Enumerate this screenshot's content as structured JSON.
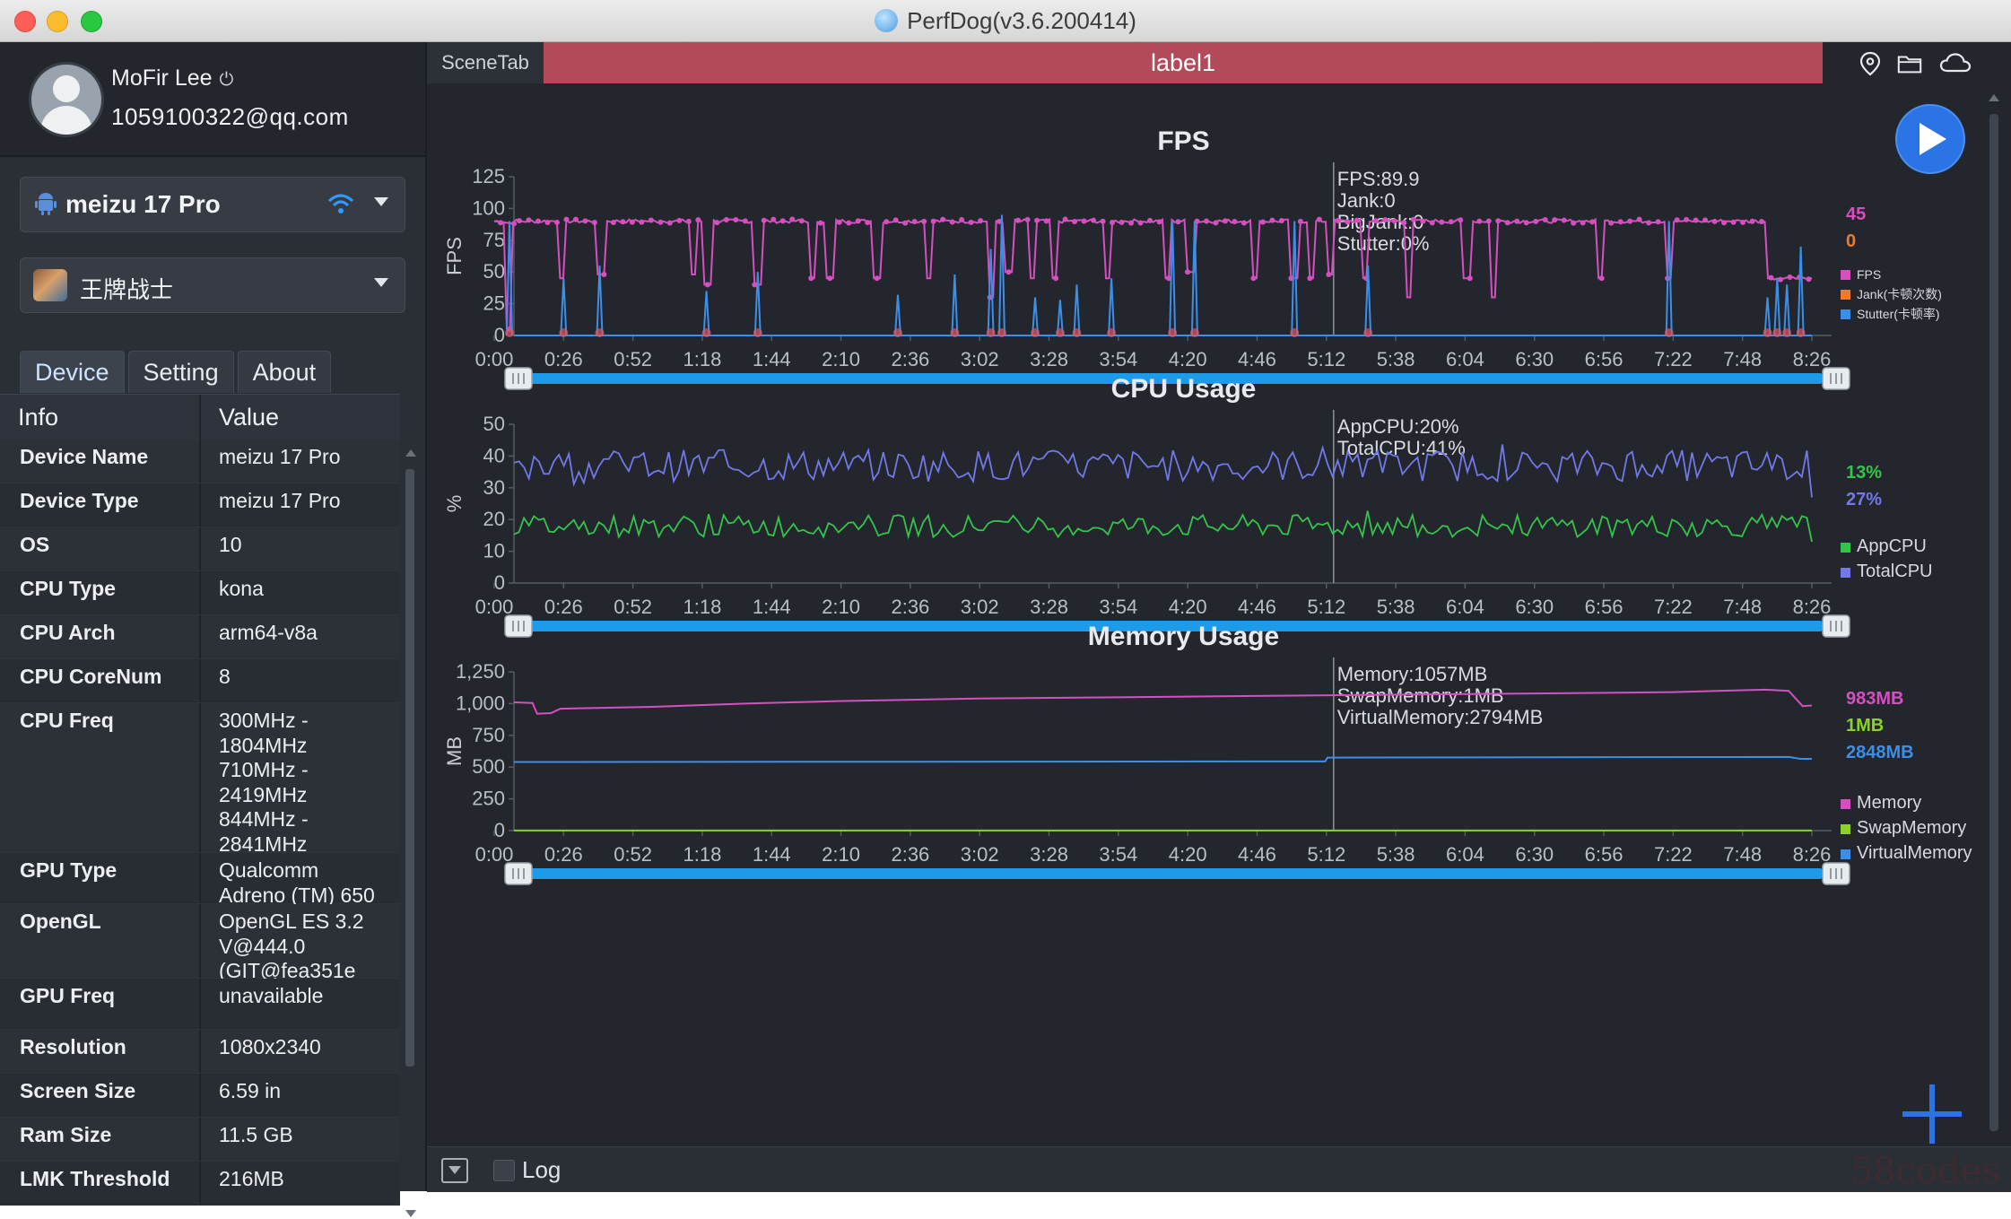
{
  "window": {
    "title": "PerfDog(v3.6.200414)"
  },
  "user": {
    "name": "MoFir Lee",
    "email": "1059100322@qq.com"
  },
  "device_selector": {
    "label": "meizu 17 Pro"
  },
  "app_selector": {
    "label": "王牌战士"
  },
  "sidebar_tabs": [
    {
      "label": "Device",
      "active": true
    },
    {
      "label": "Setting",
      "active": false
    },
    {
      "label": "About",
      "active": false
    }
  ],
  "info_table": {
    "headers": {
      "key": "Info",
      "value": "Value"
    },
    "rows": [
      {
        "key": "Device Name",
        "value": "meizu 17 Pro"
      },
      {
        "key": "Device Type",
        "value": "meizu 17 Pro"
      },
      {
        "key": "OS",
        "value": "10"
      },
      {
        "key": "CPU Type",
        "value": "kona"
      },
      {
        "key": "CPU Arch",
        "value": "arm64-v8a"
      },
      {
        "key": "CPU CoreNum",
        "value": "8"
      },
      {
        "key": "CPU Freq",
        "value": "300MHz -\n1804MHz\n710MHz -\n2419MHz\n844MHz -\n2841MHz"
      },
      {
        "key": "GPU Type",
        "value": "Qualcomm\nAdreno (TM) 650"
      },
      {
        "key": "OpenGL",
        "value": "OpenGL ES 3.2\nV@444.0\n(GIT@fea351e"
      },
      {
        "key": "GPU Freq",
        "value": "unavailable"
      },
      {
        "key": "Resolution",
        "value": "1080x2340"
      },
      {
        "key": "Screen Size",
        "value": "6.59 in"
      },
      {
        "key": "Ram Size",
        "value": "11.5 GB"
      },
      {
        "key": "LMK Threshold",
        "value": "216MB"
      }
    ]
  },
  "scene": {
    "tab_label": "SceneTab",
    "label": "label1"
  },
  "bottom": {
    "log_label": "Log",
    "watermark": "58codes"
  },
  "colors": {
    "fps": "#d64fc0",
    "jank": "#f07a2a",
    "stutter": "#3d8ee6",
    "app_cpu": "#35c44b",
    "total_cpu": "#7378e8",
    "memory": "#d64fc0",
    "swap": "#8ad12a",
    "virtual": "#3d8ee6",
    "label_bar": "#b24a5a",
    "slider": "#1e9be8"
  },
  "chart_data": [
    {
      "type": "line",
      "title": "FPS",
      "ylabel": "FPS",
      "ylim": [
        0,
        125
      ],
      "yticks": [
        "0",
        "25",
        "50",
        "75",
        "100",
        "125"
      ],
      "x_ticks": [
        "0:00",
        "0:26",
        "0:52",
        "1:18",
        "1:44",
        "2:10",
        "2:36",
        "3:02",
        "3:28",
        "3:54",
        "4:20",
        "4:46",
        "5:12",
        "5:38",
        "6:04",
        "6:30",
        "6:56",
        "7:22",
        "7:48",
        "8:26"
      ],
      "cursor": {
        "time": "5:12",
        "readout": [
          "FPS:89.9",
          "Jank:0",
          "BigJank:0",
          "Stutter:0%"
        ]
      },
      "current_values": [
        {
          "text": "45",
          "color": "#d64fc0"
        },
        {
          "text": "0",
          "color": "#f07a2a"
        }
      ],
      "legend": [
        {
          "name": "FPS",
          "color": "#d64fc0"
        },
        {
          "name": "Jank(卡顿次数)",
          "color": "#f07a2a"
        },
        {
          "name": "Stutter(卡顿率)",
          "color": "#3d8ee6"
        }
      ],
      "series": [
        {
          "name": "FPS",
          "base": 90,
          "dips": [
            {
              "t": 0.22,
              "v": 5
            },
            {
              "t": 0.98,
              "v": 45
            },
            {
              "t": 1.5,
              "v": 45
            },
            {
              "t": 1.54,
              "v": 48
            },
            {
              "t": 2.88,
              "v": 48
            },
            {
              "t": 3.08,
              "v": 40
            },
            {
              "t": 3.76,
              "v": 45
            },
            {
              "t": 3.8,
              "v": 40
            },
            {
              "t": 4.6,
              "v": 45
            },
            {
              "t": 4.84,
              "v": 45
            },
            {
              "t": 5.52,
              "v": 45
            },
            {
              "t": 6.26,
              "v": 45
            },
            {
              "t": 7.16,
              "v": 30
            },
            {
              "t": 7.42,
              "v": 50
            },
            {
              "t": 7.76,
              "v": 45
            },
            {
              "t": 8.08,
              "v": 45
            },
            {
              "t": 8.86,
              "v": 45
            },
            {
              "t": 9.72,
              "v": 45
            },
            {
              "t": 10.04,
              "v": 50
            },
            {
              "t": 10.96,
              "v": 45
            },
            {
              "t": 11.54,
              "v": 45
            },
            {
              "t": 11.8,
              "v": 45
            },
            {
              "t": 12.04,
              "v": 48
            },
            {
              "t": 12.56,
              "v": 45
            },
            {
              "t": 13.2,
              "v": 30
            },
            {
              "t": 14.02,
              "v": 45
            },
            {
              "t": 14.4,
              "v": 30
            },
            {
              "t": 15.94,
              "v": 45
            },
            {
              "t": 16.94,
              "v": 45
            },
            {
              "t": 18.38,
              "v": 45
            }
          ],
          "tail_value": 45,
          "tail_start": 18.38
        },
        {
          "name": "Stutter",
          "spikes": [
            {
              "t": 0.22,
              "v": 90
            },
            {
              "t": 1.0,
              "v": 45
            },
            {
              "t": 1.52,
              "v": 55
            },
            {
              "t": 3.06,
              "v": 35
            },
            {
              "t": 3.8,
              "v": 50
            },
            {
              "t": 5.82,
              "v": 32
            },
            {
              "t": 6.64,
              "v": 48
            },
            {
              "t": 7.16,
              "v": 68
            },
            {
              "t": 7.32,
              "v": 95
            },
            {
              "t": 7.8,
              "v": 30
            },
            {
              "t": 8.16,
              "v": 28
            },
            {
              "t": 8.4,
              "v": 40
            },
            {
              "t": 8.9,
              "v": 45
            },
            {
              "t": 9.78,
              "v": 90
            },
            {
              "t": 10.1,
              "v": 90
            },
            {
              "t": 11.54,
              "v": 90
            },
            {
              "t": 12.6,
              "v": 55
            },
            {
              "t": 16.94,
              "v": 90
            },
            {
              "t": 18.36,
              "v": 30
            },
            {
              "t": 18.5,
              "v": 45
            },
            {
              "t": 18.64,
              "v": 40
            },
            {
              "t": 18.84,
              "v": 70
            }
          ]
        }
      ]
    },
    {
      "type": "line",
      "title": "CPU Usage",
      "ylabel": "%",
      "ylim": [
        0,
        50
      ],
      "yticks": [
        "0",
        "10",
        "20",
        "30",
        "40",
        "50"
      ],
      "x_ticks": [
        "0:00",
        "0:26",
        "0:52",
        "1:18",
        "1:44",
        "2:10",
        "2:36",
        "3:02",
        "3:28",
        "3:54",
        "4:20",
        "4:46",
        "5:12",
        "5:38",
        "6:04",
        "6:30",
        "6:56",
        "7:22",
        "7:48",
        "8:26"
      ],
      "cursor": {
        "time": "5:12",
        "readout": [
          "AppCPU:20%",
          "TotalCPU:41%"
        ]
      },
      "current_values": [
        {
          "text": "13%",
          "color": "#35c44b"
        },
        {
          "text": "27%",
          "color": "#7378e8"
        }
      ],
      "legend": [
        {
          "name": "AppCPU",
          "color": "#35c44b"
        },
        {
          "name": "TotalCPU",
          "color": "#7378e8"
        }
      ],
      "series": [
        {
          "name": "TotalCPU",
          "mean": 37,
          "amp": 5,
          "end_value": 27
        },
        {
          "name": "AppCPU",
          "mean": 18,
          "amp": 3.5,
          "end_value": 13
        }
      ]
    },
    {
      "type": "line",
      "title": "Memory Usage",
      "ylabel": "MB",
      "ylim": [
        0,
        1250
      ],
      "yticks": [
        "0",
        "250",
        "500",
        "750",
        "1,000",
        "1,250"
      ],
      "x_ticks": [
        "0:00",
        "0:26",
        "0:52",
        "1:18",
        "1:44",
        "2:10",
        "2:36",
        "3:02",
        "3:28",
        "3:54",
        "4:20",
        "4:46",
        "5:12",
        "5:38",
        "6:04",
        "6:30",
        "6:56",
        "7:22",
        "7:48",
        "8:26"
      ],
      "cursor": {
        "time": "5:12",
        "readout": [
          "Memory:1057MB",
          "SwapMemory:1MB",
          "VirtualMemory:2794MB"
        ]
      },
      "current_values": [
        {
          "text": "983MB",
          "color": "#d64fc0"
        },
        {
          "text": "1MB",
          "color": "#8ad12a"
        },
        {
          "text": "2848MB",
          "color": "#3d8ee6"
        }
      ],
      "legend": [
        {
          "name": "Memory",
          "color": "#d64fc0"
        },
        {
          "name": "SwapMemory",
          "color": "#8ad12a"
        },
        {
          "name": "VirtualMemory",
          "color": "#3d8ee6"
        }
      ],
      "series": [
        {
          "name": "Memory",
          "points": [
            [
              0,
              1010
            ],
            [
              0.8,
              1005
            ],
            [
              1.0,
              920
            ],
            [
              1.6,
              925
            ],
            [
              2.0,
              960
            ],
            [
              6,
              975
            ],
            [
              10,
              1000
            ],
            [
              14,
              1020
            ],
            [
              20,
              1040
            ],
            [
              26,
              1050
            ],
            [
              32,
              1060
            ],
            [
              38,
              1070
            ],
            [
              44,
              1080
            ],
            [
              50,
              1090
            ],
            [
              54,
              1110
            ],
            [
              55,
              1100
            ],
            [
              55.6,
              980
            ],
            [
              56,
              985
            ]
          ]
        },
        {
          "name": "SwapMemory",
          "points": [
            [
              0,
              1
            ],
            [
              56,
              1
            ]
          ]
        },
        {
          "name": "VirtualMemory",
          "points": [
            [
              0,
              540
            ],
            [
              35,
              545
            ],
            [
              35.1,
              575
            ],
            [
              55,
              580
            ],
            [
              55.5,
              565
            ],
            [
              56,
              565
            ]
          ]
        }
      ]
    }
  ]
}
